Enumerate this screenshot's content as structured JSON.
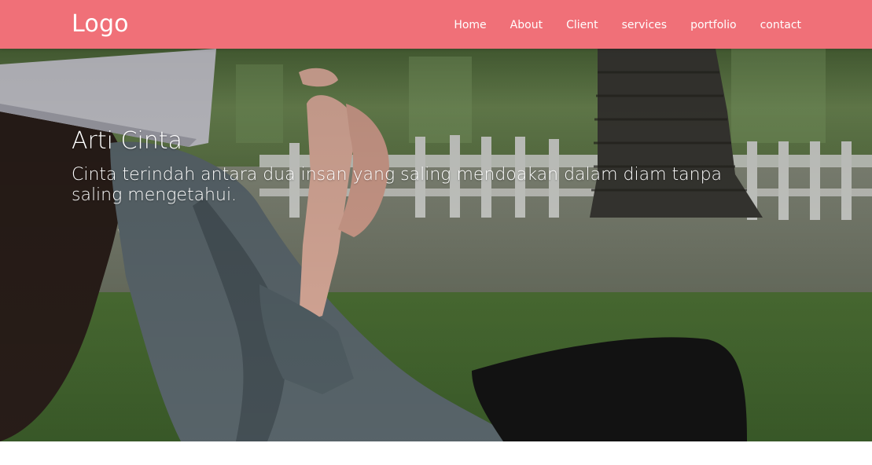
{
  "navbar": {
    "logo": "Logo",
    "menu": [
      {
        "label": "Home"
      },
      {
        "label": "About"
      },
      {
        "label": "Client"
      },
      {
        "label": "services"
      },
      {
        "label": "portfolio"
      },
      {
        "label": "contact"
      }
    ],
    "background_color": "#f07078"
  },
  "hero": {
    "title": "Arti Cinta",
    "subtitle": "Cinta terindah antara dua insan yang saling mendoakan dalam diam tanpa saling mengetahui."
  }
}
